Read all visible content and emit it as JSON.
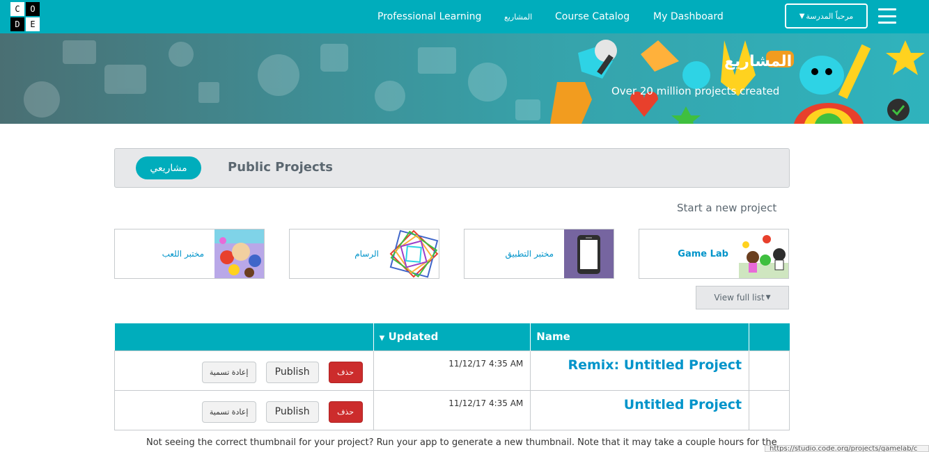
{
  "logo": {
    "letters": [
      "C",
      "O",
      "D",
      "E"
    ]
  },
  "nav": {
    "professional_learning": "Professional Learning",
    "projects": "المشاريع",
    "course_catalog": "Course Catalog",
    "my_dashboard": "My Dashboard",
    "user_menu": "مرحباً المدرسة",
    "user_menu_icon": "caret-down-icon",
    "menu_icon": "hamburger-icon"
  },
  "banner": {
    "title": "المشاريع",
    "subtitle": "Over 20 million projects created"
  },
  "tabs": {
    "mine": "مشاريعي",
    "public": "Public Projects"
  },
  "start_new": "Start a new project",
  "project_types": [
    {
      "label": "مختبر اللعب",
      "thumb": "playlab-characters"
    },
    {
      "label": "الرسام",
      "thumb": "artist-spiral"
    },
    {
      "label": "مختبر التطبيق",
      "thumb": "phone-icon"
    },
    {
      "label": "Game Lab",
      "thumb": "gamelab-characters"
    }
  ],
  "view_full_list": "View full list",
  "table": {
    "headers": {
      "actions": "",
      "updated": "Updated",
      "name": "Name",
      "extra": ""
    },
    "sort_icon": "caret-down-icon",
    "rows": [
      {
        "rename": "إعادة تسمية",
        "publish": "Publish",
        "delete": "حذف",
        "updated": "11/12/17 4:35 AM",
        "name": "Remix: Untitled Project"
      },
      {
        "rename": "إعادة تسمية",
        "publish": "Publish",
        "delete": "حذف",
        "updated": "11/12/17 4:35 AM",
        "name": "Untitled Project"
      }
    ]
  },
  "footer_note": "Not seeing the correct thumbnail for your project? Run your app to generate a new thumbnail. Note that it may take a couple hours for the",
  "status_url": "https://studio.code.org/projects/gamelab/c",
  "colors": {
    "brand": "#00adbc",
    "link": "#0094ca",
    "danger": "#cc2c2c"
  }
}
